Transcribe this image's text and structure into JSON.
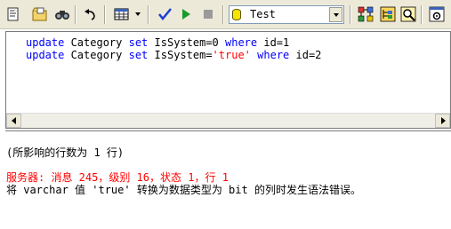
{
  "toolbar": {
    "icons": [
      "new-query-icon",
      "open-file-icon",
      "find-icon",
      "undo-icon",
      "results-grid-icon",
      "parse-checkmark-icon",
      "execute-play-icon",
      "stop-icon",
      "estimated-plan-icon",
      "object-browser-icon",
      "search-icon",
      "options-icon"
    ],
    "database": {
      "icon": "database-icon",
      "selected": "Test"
    }
  },
  "editor": {
    "lines": [
      {
        "pre": "",
        "kw1": "update",
        "mid1": " Category ",
        "kw2": "set",
        "mid2": " IsSystem=0 ",
        "kw3": "where",
        "mid3": " id=1",
        "str": ""
      },
      {
        "pre": "",
        "kw1": "update",
        "mid1": " Category ",
        "kw2": "set",
        "mid2": " IsSystem=",
        "str": "'true'",
        "kw3": "where",
        "mid3": " id=2"
      }
    ]
  },
  "results": {
    "rows_affected": "(所影响的行数为 1 行)",
    "server_error": "服务器: 消息 245，级别 16，状态 1，行 1",
    "error_message": "将 varchar 值 'true' 转换为数据类型为 bit 的列时发生语法错误。"
  },
  "colors": {
    "keyword": "#0000ff",
    "string": "#ff0000",
    "error": "#ff0000",
    "toolbar_bg": "#ece9d8"
  }
}
